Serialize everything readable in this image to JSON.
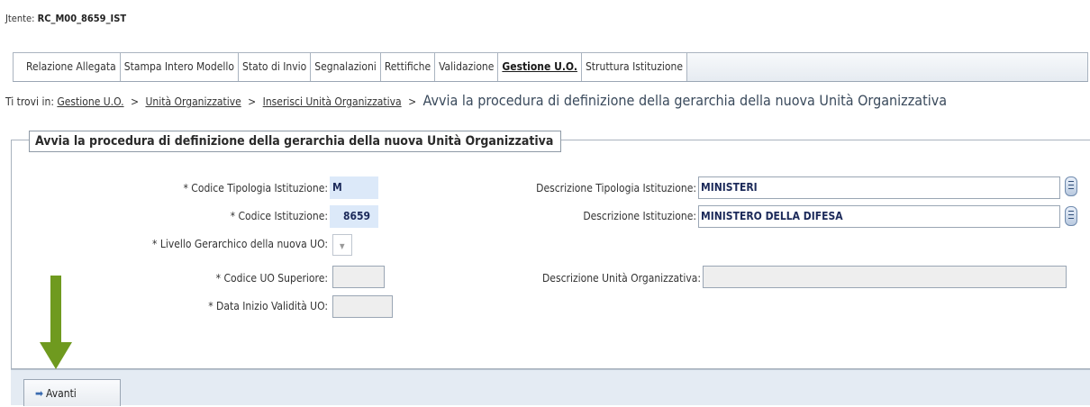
{
  "header": {
    "user_label": "Jtente:",
    "user_code": "RC_M00_8659_IST"
  },
  "tabs": [
    "Relazione Allegata",
    "Stampa Intero Modello",
    "Stato di Invio",
    "Segnalazioni",
    "Rettifiche",
    "Validazione",
    "Gestione U.O.",
    "Struttura Istituzione"
  ],
  "active_tab": "Gestione U.O.",
  "breadcrumb": {
    "prefix": "Ti trovi in:",
    "links": [
      "Gestione U.O.",
      "Unità Organizzative",
      "Inserisci Unità Organizzativa"
    ],
    "separator": ">",
    "current": "Avvia la procedura di definizione della gerarchia della nuova Unità Organizzativa"
  },
  "form": {
    "legend": "Avvia la procedura di definizione della gerarchia della nuova Unità Organizzativa",
    "codice_tipologia": {
      "label": "* Codice Tipologia Istituzione:",
      "value": "M"
    },
    "codice_istituzione": {
      "label": "* Codice Istituzione:",
      "value": "8659"
    },
    "livello_gerarchico": {
      "label": "* Livello Gerarchico della nuova UO:",
      "value": ""
    },
    "codice_uo_superiore": {
      "label": "* Codice UO Superiore:",
      "value": ""
    },
    "data_inizio": {
      "label": "* Data Inizio Validità UO:",
      "value": ""
    },
    "descr_tipologia": {
      "label": "Descrizione Tipologia Istituzione:",
      "value": "MINISTERI"
    },
    "descr_istituzione": {
      "label": "Descrizione Istituzione:",
      "value": "MINISTERO DELLA DIFESA"
    },
    "descr_unita": {
      "label": "Descrizione Unità Organizzativa:",
      "value": ""
    }
  },
  "footer": {
    "avanti_label": "Avanti",
    "avanti_icon": "arrow-right-icon"
  },
  "colors": {
    "annotation_arrow": "#6f9a1f",
    "input_blue": "#dce9f9",
    "value_text": "#1c2a5a"
  }
}
